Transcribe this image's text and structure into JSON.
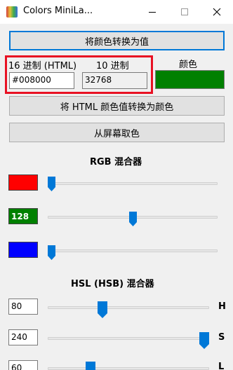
{
  "window": {
    "title": "Colors MiniLa...",
    "accent_color": "#0078d7"
  },
  "buttons": {
    "convert_to_value": "将颜色转换为值",
    "convert_html_to_color": "将 HTML 颜色值转换为颜色",
    "pick_from_screen": "从屏幕取色"
  },
  "fields": {
    "hex_label": "16 进制 (HTML)",
    "hex_value": "#008000",
    "dec_label": "10 进制",
    "dec_value": "32768",
    "color_label": "颜色",
    "color_swatch": "#008000"
  },
  "rgb": {
    "title": "RGB 混合器",
    "red": {
      "value": "",
      "color": "#ff0000",
      "level": 0
    },
    "green": {
      "value": "128",
      "color": "#008000",
      "level": 0.5
    },
    "blue": {
      "value": "",
      "color": "#0000ff",
      "level": 0
    }
  },
  "hsl": {
    "title": "HSL (HSB) 混合器",
    "h": {
      "value": "80",
      "letter": "H",
      "level": 0.33
    },
    "s": {
      "value": "240",
      "letter": "S",
      "level": 1.0
    },
    "l": {
      "value": "60",
      "letter": "L",
      "level": 0.25
    }
  }
}
